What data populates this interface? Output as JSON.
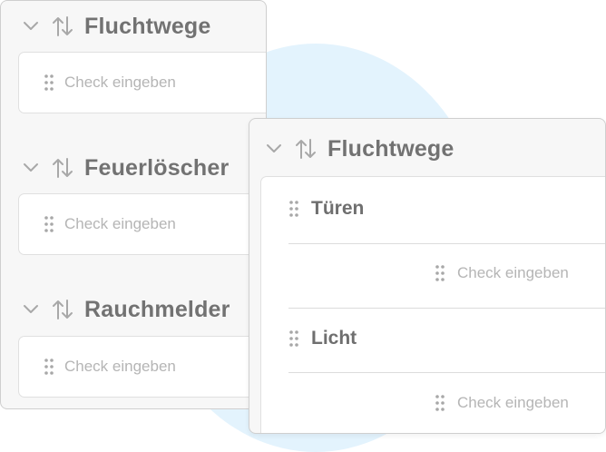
{
  "colors": {
    "accent_circle": "#e3f3fd",
    "panel_bg": "#f7f7f7",
    "title_text": "#727272",
    "placeholder_text": "#b5b5b5",
    "icon_gray": "#a8a8a8"
  },
  "left_panel": {
    "sections": [
      {
        "title": "Fluchtwege",
        "input_placeholder": "Check eingeben",
        "icons": [
          "chevron-down-icon",
          "sort-arrows-icon",
          "drag-handle-icon"
        ]
      },
      {
        "title": "Feuerlöscher",
        "input_placeholder": "Check eingeben",
        "icons": [
          "chevron-down-icon",
          "sort-arrows-icon",
          "drag-handle-icon"
        ]
      },
      {
        "title": "Rauchmelder",
        "input_placeholder": "Check eingeben",
        "icons": [
          "chevron-down-icon",
          "sort-arrows-icon",
          "drag-handle-icon"
        ]
      }
    ]
  },
  "right_panel": {
    "title": "Fluchtwege",
    "items": [
      {
        "label": "Türen",
        "input_placeholder": "Check eingeben"
      },
      {
        "label": "Licht",
        "input_placeholder": "Check eingeben"
      }
    ]
  }
}
